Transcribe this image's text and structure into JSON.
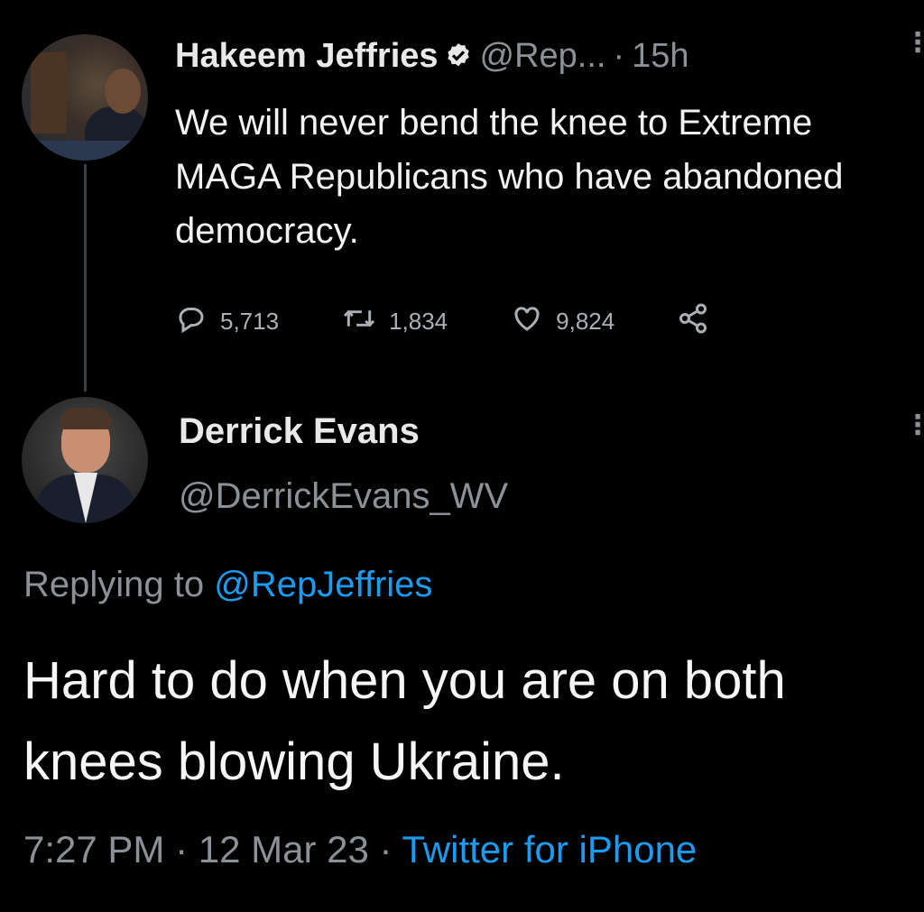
{
  "tweet1": {
    "name": "Hakeem Jeffries",
    "handle": "@Rep...",
    "time": "15h",
    "text": "We will never bend the knee to Extreme MAGA Republicans who have abandoned democracy.",
    "replies": "5,713",
    "retweets": "1,834",
    "likes": "9,824"
  },
  "tweet2": {
    "name": "Derrick Evans",
    "handle": "@DerrickEvans_WV",
    "replying_prefix": "Replying to ",
    "replying_to": "@RepJeffries",
    "text": "Hard to do when you are on both knees blowing Ukraine.",
    "time": "7:27 PM",
    "date": "12 Mar 23",
    "source": "Twitter for iPhone"
  },
  "separator": "·",
  "icons": {
    "verified": "verified-badge-icon",
    "reply": "comment-bubble-icon",
    "retweet": "retweet-icon",
    "like": "heart-icon",
    "share": "share-icon",
    "more": "vertical-ellipsis-icon"
  },
  "colors": {
    "background": "#000000",
    "text": "#e7e9ea",
    "secondary": "#8b9197",
    "link": "#1d9bf0"
  }
}
